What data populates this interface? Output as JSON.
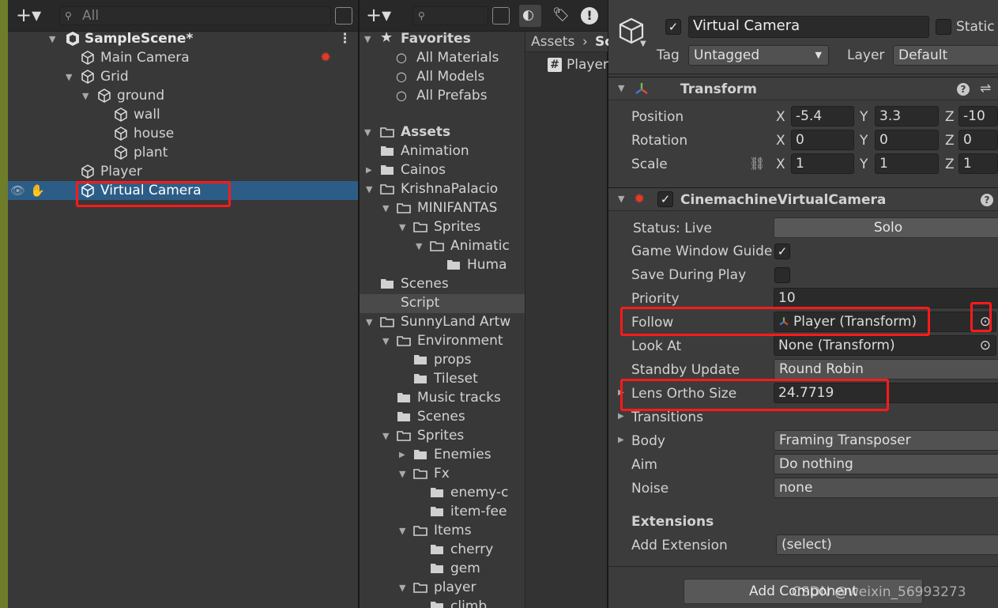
{
  "hierarchy": {
    "search_placeholder": "All",
    "scene_name": "SampleScene*",
    "items": [
      {
        "label": "Main Camera"
      },
      {
        "label": "Grid"
      },
      {
        "label": "ground"
      },
      {
        "label": "wall"
      },
      {
        "label": "house"
      },
      {
        "label": "plant"
      },
      {
        "label": "Player"
      },
      {
        "label": "Virtual Camera"
      }
    ]
  },
  "project": {
    "favorites_label": "Favorites",
    "favorites": [
      "All Materials",
      "All Models",
      "All Prefabs"
    ],
    "assets_label": "Assets",
    "tree": [
      "Animation",
      "Cainos",
      "KrishnaPalacio",
      "MINIFANTAS",
      "Sprites",
      "Animatic",
      "Huma",
      "Scenes",
      "Script",
      "SunnyLand Artw",
      "Environment",
      "props",
      "Tileset",
      "Music tracks",
      "Scenes",
      "Sprites",
      "Enemies",
      "Fx",
      "enemy-c",
      "item-fee",
      "Items",
      "cherry",
      "gem",
      "player",
      "climb"
    ],
    "breadcrumb_root": "Assets",
    "breadcrumb_next": "Sc",
    "file_item": "Player"
  },
  "inspector": {
    "object_name": "Virtual Camera",
    "static_label": "Static",
    "tag_label": "Tag",
    "tag_value": "Untagged",
    "layer_label": "Layer",
    "layer_value": "Default",
    "transform": {
      "title": "Transform",
      "position_label": "Position",
      "rotation_label": "Rotation",
      "scale_label": "Scale",
      "axis_x": "X",
      "axis_y": "Y",
      "axis_z": "Z",
      "position": {
        "x": "-5.4",
        "y": "3.3",
        "z": "-10"
      },
      "rotation": {
        "x": "0",
        "y": "0",
        "z": "0"
      },
      "scale": {
        "x": "1",
        "y": "1",
        "z": "1"
      }
    },
    "cinemachine": {
      "title": "CinemachineVirtualCamera",
      "status_label": "Status: Live",
      "solo_label": "Solo",
      "game_window_guides_label": "Game Window Guide",
      "save_during_play_label": "Save During Play",
      "priority_label": "Priority",
      "priority_value": "10",
      "follow_label": "Follow",
      "follow_value": "Player (Transform)",
      "look_at_label": "Look At",
      "look_at_value": "None (Transform)",
      "standby_update_label": "Standby Update",
      "standby_update_value": "Round Robin",
      "lens_label": "Lens Ortho Size",
      "lens_value": "24.7719",
      "transitions_label": "Transitions",
      "body_label": "Body",
      "body_value": "Framing Transposer",
      "aim_label": "Aim",
      "aim_value": "Do nothing",
      "noise_label": "Noise",
      "noise_value": "none",
      "extensions_label": "Extensions",
      "add_extension_label": "Add Extension",
      "add_extension_value": "(select)"
    },
    "add_component_label": "Add Component",
    "watermark": "CSDN @weixin_56993273"
  },
  "colors": {
    "selection": "#2c5d87",
    "highlight_box": "#ff1a1a"
  }
}
